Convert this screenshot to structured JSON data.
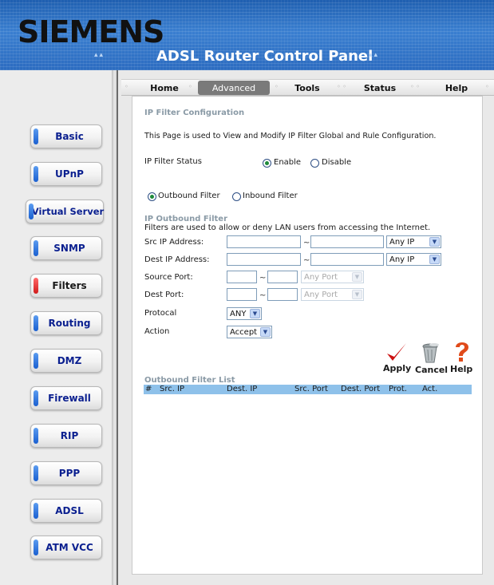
{
  "header": {
    "brand": "SIEMENS",
    "subtitle": "ADSL Router Control Panel",
    "dots_left": "▴▴",
    "dots_right": "▴▴"
  },
  "topnav": {
    "items": [
      {
        "label": "Home"
      },
      {
        "label": "Advanced"
      },
      {
        "label": "Tools"
      },
      {
        "label": "Status"
      },
      {
        "label": "Help"
      }
    ],
    "active": "Advanced"
  },
  "sidebar": {
    "items": [
      {
        "label": "Basic"
      },
      {
        "label": "UPnP"
      },
      {
        "label": "Virtual Server"
      },
      {
        "label": "SNMP"
      },
      {
        "label": "Filters"
      },
      {
        "label": "Routing"
      },
      {
        "label": "DMZ"
      },
      {
        "label": "Firewall"
      },
      {
        "label": "RIP"
      },
      {
        "label": "PPP"
      },
      {
        "label": "ADSL"
      },
      {
        "label": "ATM VCC"
      }
    ],
    "active": "Filters"
  },
  "page": {
    "title": "IP Filter Configuration",
    "description": "This Page is used to View and Modify IP Filter Global and Rule Configuration.",
    "status_label": "IP Filter Status",
    "enable_label": "Enable",
    "disable_label": "Disable",
    "status_value": "Enable",
    "outbound_label": "Outbound Filter",
    "inbound_label": "Inbound Filter",
    "filter_mode": "Outbound Filter",
    "outbound_title": "IP Outbound Filter",
    "outbound_desc": "Filters are used to allow or deny LAN users from accessing the Internet.",
    "src_ip_label": "Src IP Address:",
    "dest_ip_label": "Dest IP Address:",
    "source_port_label": "Source Port:",
    "dest_port_label": "Dest Port:",
    "protocol_label": "Protocal",
    "action_label": "Action",
    "range_sep": "~",
    "src_ip_from": "",
    "src_ip_to": "",
    "src_ip_mode": "Any IP",
    "dest_ip_from": "",
    "dest_ip_to": "",
    "dest_ip_mode": "Any IP",
    "source_port_from": "",
    "source_port_to": "",
    "source_port_mode": "Any Port",
    "dest_port_from": "",
    "dest_port_to": "",
    "dest_port_mode": "Any Port",
    "protocol_value": "ANY",
    "action_value": "Accept"
  },
  "actions": {
    "apply": "Apply",
    "cancel": "Cancel",
    "help": "Help",
    "apply_icon": "checkmark-icon",
    "cancel_icon": "trash-can-icon",
    "help_icon": "question-mark-icon"
  },
  "list": {
    "title": "Outbound Filter List",
    "columns": [
      "#",
      "Src. IP",
      "Dest. IP",
      "Src. Port",
      "Dest. Port",
      "Prot.",
      "Act."
    ],
    "rows": []
  },
  "colors": {
    "header_blue": "#2c6cc0",
    "sidebar_text": "#0a1f8f",
    "section_title": "#8a9aa6",
    "table_header": "#8ec1ea",
    "apply_check": "#cc1111",
    "help_mark": "#e04a1a"
  }
}
